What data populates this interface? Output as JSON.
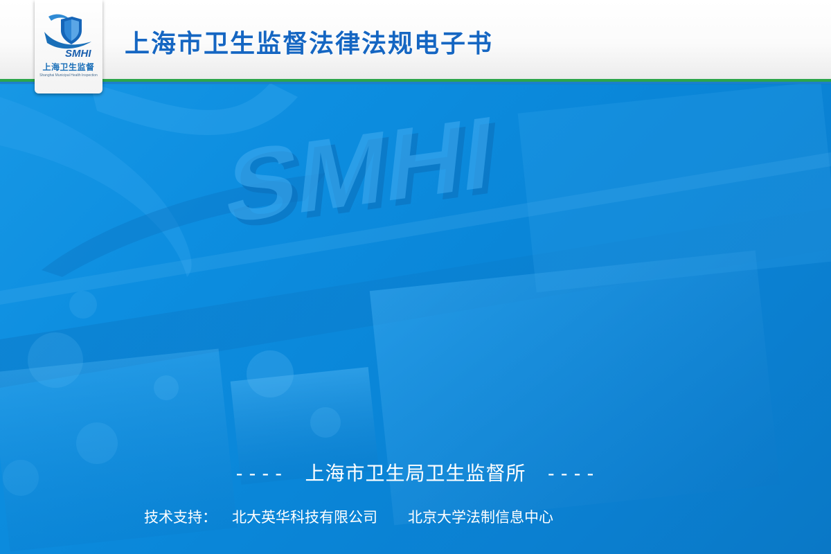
{
  "header": {
    "title": "上海市卫生监督法律法规电子书"
  },
  "logo": {
    "wordmark": "SMHI",
    "cn_name": "上海卫生监督",
    "en_name": "Shanghai Municipal Health Inspection"
  },
  "background": {
    "wordmark": "SMHI"
  },
  "footer": {
    "dash_left": "----",
    "organization": "上海市卫生局卫生监督所",
    "dash_right": "----",
    "support_label": "技术支持：",
    "company_1": "北大英华科技有限公司",
    "company_2": "北京大学法制信息中心"
  },
  "colors": {
    "background_blue": "#0d8ee0",
    "title_blue": "#1566c2",
    "accent_green": "#2ca64a",
    "text_white": "#ffffff"
  }
}
